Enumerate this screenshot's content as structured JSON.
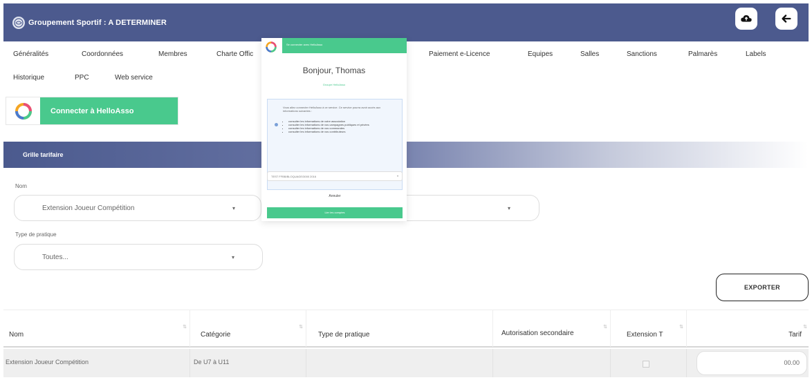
{
  "header": {
    "title": "Groupement Sportif : A DETERMINER",
    "color": "#4c5a8e"
  },
  "nav": {
    "row1": [
      "Généralités",
      "Coordonnées",
      "Membres",
      "Charte Offic",
      "Paiement e-Licence",
      "Equipes",
      "Salles",
      "Sanctions",
      "Palmarès",
      "Labels"
    ],
    "row2": [
      "Historique",
      "PPC",
      "Web service"
    ]
  },
  "helloasso": {
    "connect_label": "Connecter à HelloAsso",
    "accent": "#49c98d"
  },
  "section": {
    "title": "Grille tarifaire"
  },
  "filters": {
    "nom_label": "Nom",
    "nom_value": "Extension Joueur Compétition",
    "type_label": "Type de pratique",
    "type_value": "Toutes..."
  },
  "export_label": "EXPORTER",
  "table": {
    "headers": [
      "Nom",
      "Catégorie",
      "Type de pratique",
      "Autorisation secondaire",
      "Extension T",
      "Tarif"
    ],
    "rows": [
      {
        "nom": "Extension Joueur Compétition",
        "categorie": "De U7 à U11",
        "type": "",
        "autorisation": "",
        "extension": false,
        "tarif": "00.00"
      }
    ]
  },
  "modal": {
    "bar_text": "Se connecter avec HelloAsso",
    "greeting": "Bonjour, Thomas",
    "org": "Groupe HelloAsso",
    "intro": "Vous allez connecter HelloAsso à ce service. Ce service pourra avoir accès aux informations suivantes :",
    "bullets": [
      "consulter les informations de votre association",
      "consulter les informations de vos campagnes publiques et privées",
      "consulter les informations de vos commandes",
      "consulter les informations de vos contributeurs"
    ],
    "select_value": "TEST FFBB/BLOQUAGE/3000 2016",
    "cancel": "Annuler",
    "link": "Lier les comptes"
  }
}
